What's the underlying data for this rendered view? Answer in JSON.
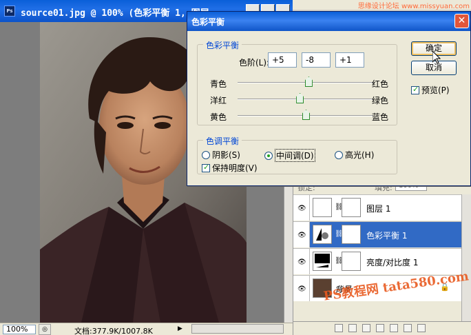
{
  "doc_window": {
    "title": "source01.jpg @ 100% (色彩平衡 1，RGB...",
    "title_visible": "source01.jpg @ 100% (色彩平衡 1, 图层",
    "ps_icon": "Ps",
    "zoom": "100%",
    "doc_info": "文档:377.9K/1007.8K"
  },
  "dialog": {
    "title": "色彩平衡",
    "color_balance_group": {
      "legend": "色彩平衡",
      "levels_label": "色阶(L):",
      "levels": [
        "+5",
        "-8",
        "+1"
      ],
      "sliders": [
        {
          "left": "青色",
          "right": "红色",
          "value": 5
        },
        {
          "left": "洋红",
          "right": "绿色",
          "value": -8
        },
        {
          "left": "黄色",
          "right": "蓝色",
          "value": 1
        }
      ]
    },
    "tone_balance_group": {
      "legend": "色调平衡",
      "shadows": "阴影(S)",
      "midtones": "中间调(D)",
      "highlights": "高光(H)",
      "selected": "midtones",
      "preserve_luminosity": "保持明度(V)"
    },
    "ok_label": "确定",
    "cancel_label": "取消",
    "preview_label": "预览(P)"
  },
  "layers": {
    "opts_lock": "锁定:",
    "opts_fill": "填充:",
    "opts_fill_value": "100%",
    "items": [
      {
        "name": "图层 1",
        "selected": false
      },
      {
        "name": "色彩平衡 1",
        "selected": true
      },
      {
        "name": "亮度/对比度 1",
        "selected": false
      },
      {
        "name": "背景",
        "selected": false
      }
    ]
  },
  "watermarks": {
    "top_right": "思缘设计论坛 www.missyuan.com",
    "bottom": "PS教程网 tata580.com"
  },
  "colors": {
    "titlebar": "#0a5fd8",
    "selected_layer": "#316ac5",
    "dialog_bg": "#ece9d8",
    "group_legend": "#0046d5"
  },
  "icons": [
    "ps-icon",
    "close-icon",
    "eye-icon",
    "chain-link-icon",
    "lock-icon",
    "cursor-icon"
  ]
}
